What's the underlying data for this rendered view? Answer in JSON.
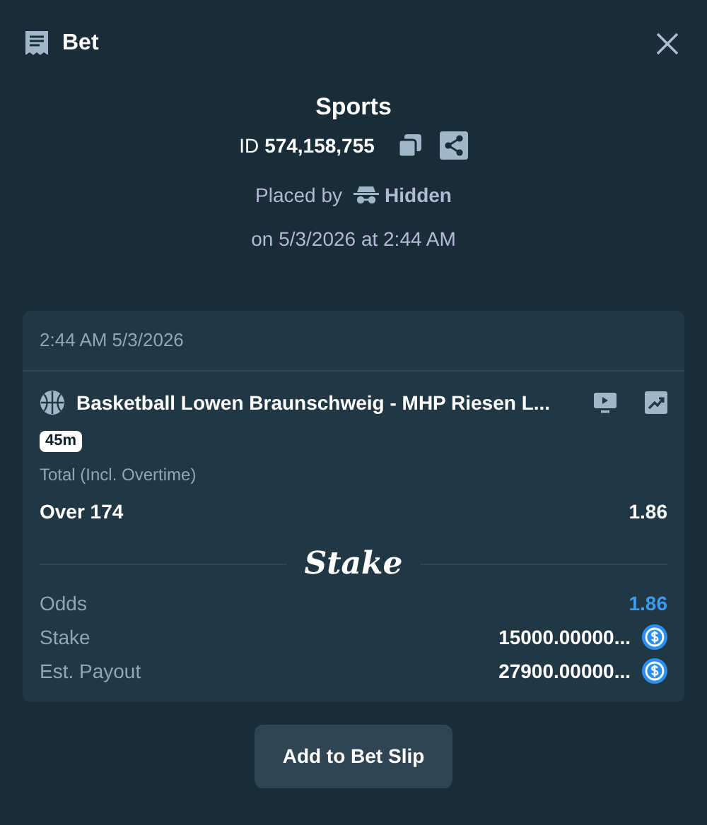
{
  "header": {
    "title": "Bet"
  },
  "summary": {
    "category": "Sports",
    "id_label": "ID",
    "id_value": "574,158,755",
    "placed_by_label": "Placed by",
    "placed_by_user": "Hidden",
    "placed_on": "on 5/3/2026 at 2:44 AM"
  },
  "bet_card": {
    "timestamp": "2:44 AM 5/3/2026",
    "event": "Basketball Lowen Braunschweig - MHP Riesen L...",
    "live_time": "45m",
    "market": "Total (Incl. Overtime)",
    "selection": "Over 174",
    "selection_odds": "1.86",
    "brand": "Stake",
    "rows": [
      {
        "kind": "odds",
        "label": "Odds",
        "value": "1.86"
      },
      {
        "kind": "amount",
        "label": "Stake",
        "value": "15000.00000..."
      },
      {
        "kind": "amount",
        "label": "Est. Payout",
        "value": "27900.00000..."
      }
    ]
  },
  "action": {
    "label": "Add to Bet Slip"
  }
}
